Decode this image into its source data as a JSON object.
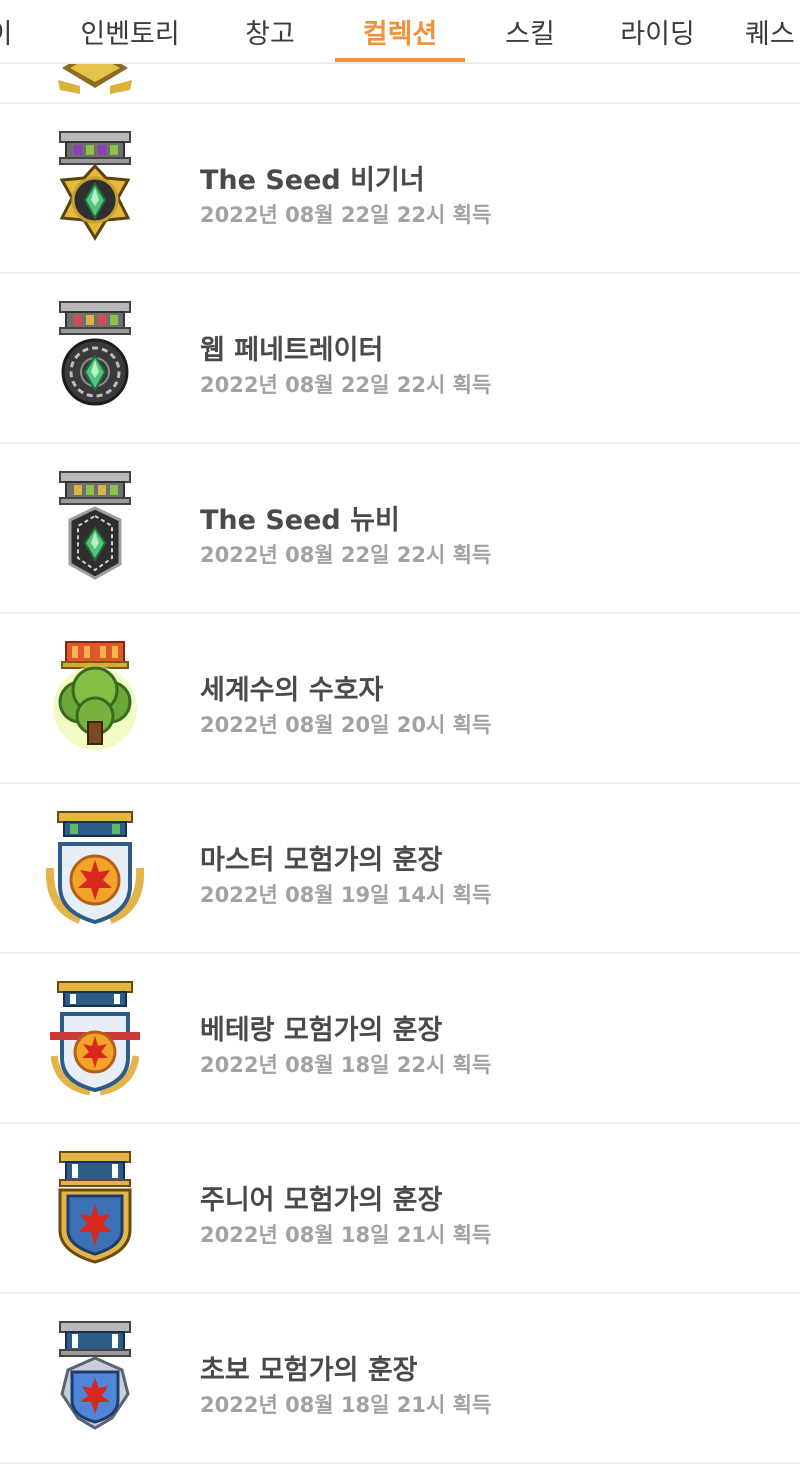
{
  "tabs": [
    {
      "label": "이",
      "active": false
    },
    {
      "label": "인벤토리",
      "active": false
    },
    {
      "label": "창고",
      "active": false
    },
    {
      "label": "컬렉션",
      "active": true
    },
    {
      "label": "스킬",
      "active": false
    },
    {
      "label": "라이딩",
      "active": false
    },
    {
      "label": "퀘스",
      "active": false
    }
  ],
  "colors": {
    "accent": "#f0923a",
    "title_text": "#4a4a4a",
    "date_text": "#a2a2a2",
    "divider": "#f0f0f0"
  },
  "medals": [
    {
      "name": "The Seed 비기너",
      "date": "2022년 08월 22일 22시 획득",
      "icon": "seed-beginner-medal-icon"
    },
    {
      "name": "웹 페네트레이터",
      "date": "2022년 08월 22일 22시 획득",
      "icon": "web-penetrator-medal-icon"
    },
    {
      "name": "The Seed 뉴비",
      "date": "2022년 08월 22일 22시 획득",
      "icon": "seed-newbie-medal-icon"
    },
    {
      "name": "세계수의 수호자",
      "date": "2022년 08월 20일 20시 획득",
      "icon": "world-tree-guardian-medal-icon"
    },
    {
      "name": "마스터 모험가의 훈장",
      "date": "2022년 08월 19일 14시 획득",
      "icon": "master-adventurer-medal-icon"
    },
    {
      "name": "베테랑 모험가의 훈장",
      "date": "2022년 08월 18일 22시 획득",
      "icon": "veteran-adventurer-medal-icon"
    },
    {
      "name": "주니어 모험가의 훈장",
      "date": "2022년 08월 18일 21시 획득",
      "icon": "junior-adventurer-medal-icon"
    },
    {
      "name": "초보 모험가의 훈장",
      "date": "2022년 08월 18일 21시 획득",
      "icon": "novice-adventurer-medal-icon"
    }
  ]
}
